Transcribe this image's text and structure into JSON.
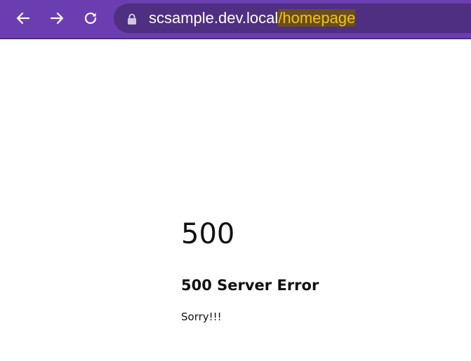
{
  "browser": {
    "url_host": "scsample.dev.local",
    "url_path": "/homepage",
    "icons": {
      "back": "arrow-left-icon",
      "forward": "arrow-right-icon",
      "reload": "reload-icon",
      "lock": "lock-icon"
    }
  },
  "page": {
    "code": "500",
    "title": "500 Server Error",
    "message": "Sorry!!!"
  },
  "colors": {
    "toolbar": "#6a3eb0",
    "omnibox": "#4f2f82",
    "url_highlight_text": "#f1c40f",
    "url_highlight_bg": "#6a4e1e"
  }
}
